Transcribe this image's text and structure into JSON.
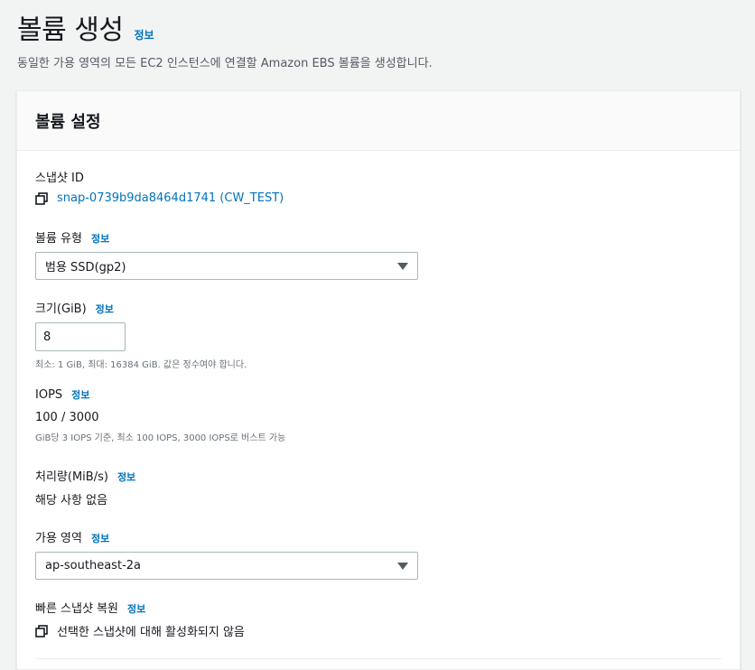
{
  "header": {
    "title": "볼륨 생성",
    "info": "정보",
    "description": "동일한 가용 영역의 모든 EC2 인스턴스에 연결할 Amazon EBS 볼륨을 생성합니다."
  },
  "panel": {
    "title": "볼륨 설정",
    "snapshot": {
      "label": "스냅샷 ID",
      "value": "snap-0739b9da8464d1741 (CW_TEST)",
      "icon": "copy-icon"
    },
    "volume_type": {
      "label": "볼륨 유형",
      "info": "정보",
      "selected": "범용 SSD(gp2)"
    },
    "size": {
      "label": "크기(GiB)",
      "info": "정보",
      "value": "8",
      "hint": "최소: 1 GiB, 최대: 16384 GiB. 값은 정수여야 합니다."
    },
    "iops": {
      "label": "IOPS",
      "info": "정보",
      "value": "100 / 3000",
      "hint": "GiB당 3 IOPS 기준, 최소 100 IOPS, 3000 IOPS로 버스트 가능"
    },
    "throughput": {
      "label": "처리량(MiB/s)",
      "info": "정보",
      "value": "해당 사항 없음"
    },
    "availability_zone": {
      "label": "가용 영역",
      "info": "정보",
      "selected": "ap-southeast-2a"
    },
    "fast_restore": {
      "label": "빠른 스냅샷 복원",
      "info": "정보",
      "value": "선택한 스냅샷에 대해 활성화되지 않음",
      "icon": "copy-icon"
    }
  },
  "colors": {
    "link": "#0073bb",
    "background": "#f2f3f3",
    "border": "#aab7b8"
  }
}
